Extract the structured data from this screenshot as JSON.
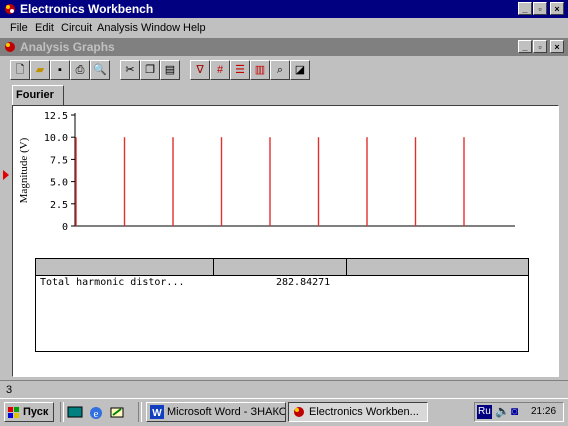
{
  "window": {
    "title": "Electronics Workbench"
  },
  "menu": [
    "File",
    "Edit",
    "Circuit",
    "Analysis",
    "Window",
    "Help"
  ],
  "child": {
    "title": "Analysis Graphs"
  },
  "toolbar_icons": [
    "new-icon",
    "open-icon",
    "save-icon",
    "print-icon",
    "print-preview-icon",
    "cut-icon",
    "copy-icon",
    "paste-icon",
    "toggle-cursors-icon",
    "toggle-grid-icon",
    "toggle-legend-icon",
    "toggle-legend2-icon",
    "zoom-icon",
    "restore-icon"
  ],
  "tab": {
    "label": "Fourier"
  },
  "chart_data": {
    "type": "bar",
    "ylabel": "Magnitude (V)",
    "yticks": [
      "12.5",
      "10.0",
      "7.5",
      "5.0",
      "2.5",
      "0"
    ],
    "ylim": [
      0,
      12.5
    ],
    "x": [
      1,
      2,
      3,
      4,
      5,
      6,
      7,
      8,
      9
    ],
    "values": [
      10,
      10,
      10,
      10,
      10,
      10,
      10,
      10,
      10
    ],
    "grid": false,
    "color": "#e03030"
  },
  "results": {
    "columns": [
      "",
      "",
      ""
    ],
    "rows": [
      {
        "label": "Total harmonic distor...",
        "value": "282.84271"
      }
    ]
  },
  "status": {
    "text": "3"
  },
  "taskbar": {
    "start": "Пуск",
    "tasks": [
      {
        "label": "Microsoft Word - ЗНАКОМ..."
      },
      {
        "label": "Electronics Workben..."
      }
    ],
    "tray": {
      "lang": "Ru",
      "clock": "21:26"
    }
  }
}
